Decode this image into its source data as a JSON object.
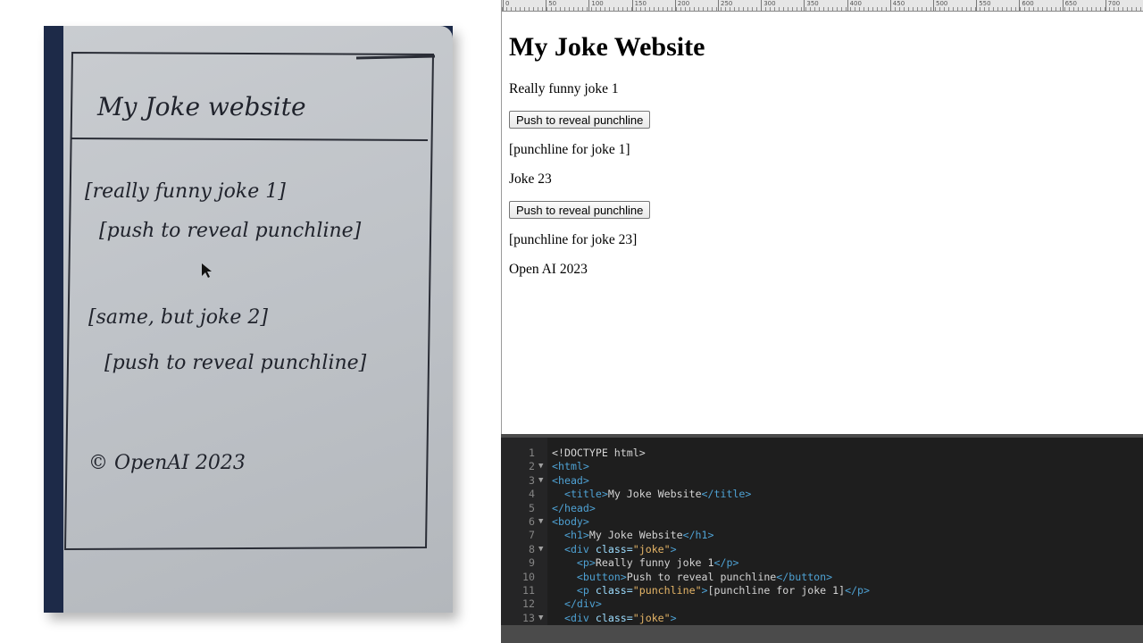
{
  "sketch": {
    "title": "My Joke website",
    "joke1": "[really funny joke 1]",
    "reveal1": "[push to reveal punchline]",
    "joke2": "[same, but joke 2]",
    "reveal2": "[push to reveal punchline]",
    "footer": "© OpenAI 2023"
  },
  "ruler": {
    "ticks": [
      "0",
      "50",
      "100",
      "150",
      "200",
      "250",
      "300",
      "350",
      "400",
      "450",
      "500",
      "550",
      "600",
      "650",
      "700"
    ]
  },
  "render": {
    "heading": "My Joke Website",
    "joke1": "Really funny joke 1",
    "button1": "Push to reveal punchline",
    "punchline1": "[punchline for joke 1]",
    "joke2": "Joke 23",
    "button2": "Push to reveal punchline",
    "punchline2": "[punchline for joke 23]",
    "footer": "Open AI 2023"
  },
  "editor": {
    "lines": [
      {
        "n": "1",
        "fold": "",
        "segs": [
          [
            "doc",
            "<!DOCTYPE html>"
          ]
        ]
      },
      {
        "n": "2",
        "fold": "▼",
        "segs": [
          [
            "tag",
            "<html>"
          ]
        ]
      },
      {
        "n": "3",
        "fold": "▼",
        "segs": [
          [
            "tag",
            "<head>"
          ]
        ]
      },
      {
        "n": "4",
        "fold": "",
        "segs": [
          [
            "txt",
            "  "
          ],
          [
            "tag",
            "<title>"
          ],
          [
            "txt",
            "My Joke Website"
          ],
          [
            "tag",
            "</title>"
          ]
        ]
      },
      {
        "n": "5",
        "fold": "",
        "segs": [
          [
            "tag",
            "</head>"
          ]
        ]
      },
      {
        "n": "6",
        "fold": "▼",
        "segs": [
          [
            "tag",
            "<body>"
          ]
        ]
      },
      {
        "n": "7",
        "fold": "",
        "segs": [
          [
            "txt",
            "  "
          ],
          [
            "tag",
            "<h1>"
          ],
          [
            "txt",
            "My Joke Website"
          ],
          [
            "tag",
            "</h1>"
          ]
        ]
      },
      {
        "n": "8",
        "fold": "▼",
        "segs": [
          [
            "txt",
            "  "
          ],
          [
            "tag",
            "<div "
          ],
          [
            "attr",
            "class="
          ],
          [
            "val",
            "\"joke\""
          ],
          [
            "tag",
            ">"
          ]
        ]
      },
      {
        "n": "9",
        "fold": "",
        "segs": [
          [
            "txt",
            "    "
          ],
          [
            "tag",
            "<p>"
          ],
          [
            "txt",
            "Really funny joke 1"
          ],
          [
            "tag",
            "</p>"
          ]
        ]
      },
      {
        "n": "10",
        "fold": "",
        "segs": [
          [
            "txt",
            "    "
          ],
          [
            "tag",
            "<button>"
          ],
          [
            "txt",
            "Push to reveal punchline"
          ],
          [
            "tag",
            "</button>"
          ]
        ]
      },
      {
        "n": "11",
        "fold": "",
        "segs": [
          [
            "txt",
            "    "
          ],
          [
            "tag",
            "<p "
          ],
          [
            "attr",
            "class="
          ],
          [
            "val",
            "\"punchline\""
          ],
          [
            "tag",
            ">"
          ],
          [
            "txt",
            "[punchline for joke 1]"
          ],
          [
            "tag",
            "</p>"
          ]
        ]
      },
      {
        "n": "12",
        "fold": "",
        "segs": [
          [
            "txt",
            "  "
          ],
          [
            "tag",
            "</div>"
          ]
        ]
      },
      {
        "n": "13",
        "fold": "▼",
        "segs": [
          [
            "txt",
            "  "
          ],
          [
            "tag",
            "<div "
          ],
          [
            "attr",
            "class="
          ],
          [
            "val",
            "\"joke\""
          ],
          [
            "tag",
            ">"
          ]
        ]
      }
    ]
  }
}
